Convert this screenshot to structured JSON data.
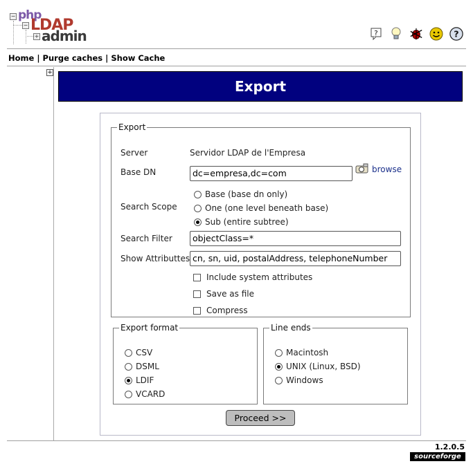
{
  "logo": {
    "php": "php",
    "ldap": "LDAP",
    "admin": "admin"
  },
  "header_icons": [
    "help-icon",
    "lightbulb-icon",
    "bug-icon",
    "smiley-icon",
    "question-icon"
  ],
  "nav": {
    "home": "Home",
    "purge": "Purge caches",
    "show_cache": "Show Cache",
    "sep": "|"
  },
  "page_title": "Export",
  "export": {
    "legend": "Export",
    "server_label": "Server",
    "server_value": "Servidor LDAP de l'Empresa",
    "base_dn_label": "Base DN",
    "base_dn_value": "dc=empresa,dc=com",
    "browse_label": "browse",
    "scope_label": "Search Scope",
    "scope_options": [
      {
        "label": "Base (base dn only)",
        "checked": false
      },
      {
        "label": "One (one level beneath base)",
        "checked": false
      },
      {
        "label": "Sub (entire subtree)",
        "checked": true
      }
    ],
    "filter_label": "Search Filter",
    "filter_value": "objectClass=*",
    "attrs_label": "Show Attributtes",
    "attrs_value": "cn, sn, uid, postalAddress, telephoneNumber",
    "checkboxes": [
      {
        "label": "Include system attributes",
        "checked": false
      },
      {
        "label": "Save as file",
        "checked": false
      },
      {
        "label": "Compress",
        "checked": false
      }
    ]
  },
  "format": {
    "legend": "Export format",
    "options": [
      {
        "label": "CSV",
        "checked": false
      },
      {
        "label": "DSML",
        "checked": false
      },
      {
        "label": "LDIF",
        "checked": true
      },
      {
        "label": "VCARD",
        "checked": false
      }
    ]
  },
  "line_ends": {
    "legend": "Line ends",
    "options": [
      {
        "label": "Macintosh",
        "checked": false
      },
      {
        "label": "UNIX (Linux, BSD)",
        "checked": true
      },
      {
        "label": "Windows",
        "checked": false
      }
    ]
  },
  "proceed_label": "Proceed >>",
  "footer": {
    "version": "1.2.0.5",
    "sourceforge": "sourceforge"
  },
  "colors": {
    "title_bar": "#01017f",
    "link": "#1a2f8a"
  }
}
